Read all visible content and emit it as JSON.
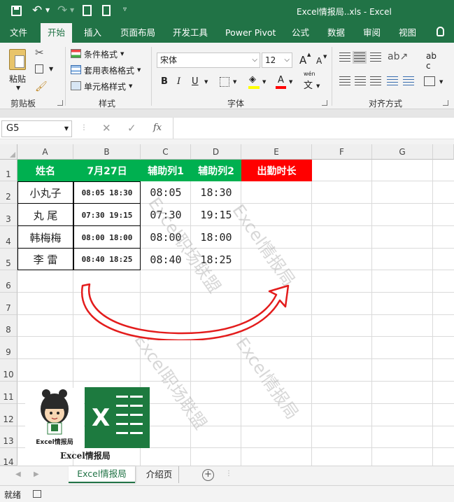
{
  "window": {
    "title": "Excel情报局..xls  -  Excel"
  },
  "ribbon_tabs": [
    "文件",
    "开始",
    "插入",
    "页面布局",
    "开发工具",
    "Power Pivot",
    "公式",
    "数据",
    "审阅",
    "视图"
  ],
  "clipboard": {
    "paste_label": "粘贴",
    "group_label": "剪贴板"
  },
  "styles": {
    "conditional": "条件格式",
    "table": "套用表格格式",
    "cell": "单元格样式",
    "group_label": "样式"
  },
  "font": {
    "name": "宋体",
    "size": "12",
    "bold": "B",
    "italic": "I",
    "underline": "U",
    "font_color_label": "A",
    "grow": "A",
    "shrink": "A",
    "phonetic_top": "wén",
    "phonetic": "文",
    "group_label": "字体"
  },
  "alignment": {
    "wrap": "ab",
    "wrap2": "c",
    "group_label": "对齐方式"
  },
  "formula_bar": {
    "name_box": "G5",
    "fx": "fx",
    "formula": ""
  },
  "columns": [
    "A",
    "B",
    "C",
    "D",
    "E",
    "F",
    "G"
  ],
  "rows": [
    "1",
    "2",
    "3",
    "4",
    "5",
    "6",
    "7",
    "8",
    "9",
    "10",
    "11",
    "12",
    "13",
    "14"
  ],
  "table": {
    "headers": [
      "姓名",
      "7月27日",
      "辅助列1",
      "辅助列2",
      "出勤时长"
    ],
    "rows": [
      [
        "小丸子",
        "08:05  18:30",
        "08:05",
        "18:30"
      ],
      [
        "丸    尾",
        "07:30  19:15",
        "07:30",
        "19:15"
      ],
      [
        "韩梅梅",
        "08:00  18:00",
        "08:00",
        "18:00"
      ],
      [
        "李    雷",
        "08:40  18:25",
        "08:40",
        "18:25"
      ]
    ]
  },
  "colors": {
    "header_green": "#00b050",
    "header_red": "#ff0000",
    "excel_green": "#217346",
    "arrow_red": "#e31c1c"
  },
  "watermarks": [
    "Excel情报局",
    "Excel职场联盟",
    "Excel职场联盟",
    "Excel情报局"
  ],
  "logo": {
    "badge_text": "Excel情报局",
    "caption": "Excel情报局"
  },
  "sheet_tabs": [
    "Excel情报局",
    "介绍页"
  ],
  "status": {
    "ready": "就绪"
  }
}
